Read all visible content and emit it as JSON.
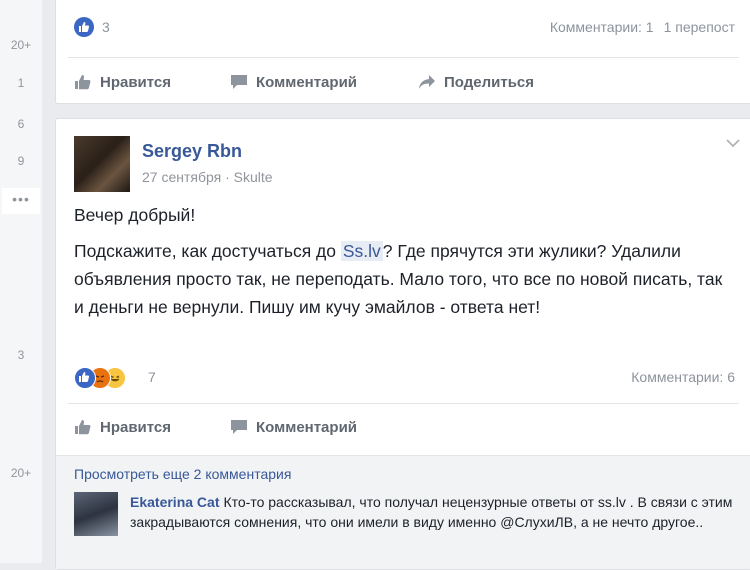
{
  "gutter": {
    "numbers": [
      "20+",
      "1",
      "6",
      "9",
      "3",
      "20+"
    ],
    "dots": "•••"
  },
  "post1": {
    "likes": "3",
    "comments": "Комментарии: 1",
    "shares": "1 перепост",
    "actions": {
      "like": "Нравится",
      "comment": "Комментарий",
      "share": "Поделиться"
    }
  },
  "post2": {
    "author": "Sergey Rbn",
    "date": "27 сентября",
    "location": "Skulte",
    "separator": "·",
    "greeting": "Вечер добрый!",
    "text_before_link": "Подскажите, как достучаться до ",
    "link": "Ss.lv",
    "text_after_link": "? Где прячутся эти жулики? Удалили объявления просто так, не переподать. Мало того, что все по новой писать, так и деньги не вернули. Пишу им кучу эмайлов - ответа нет!",
    "reaction_count": "7",
    "comments": "Комментарии: 6",
    "actions": {
      "like": "Нравится",
      "comment": "Комментарий"
    },
    "more_comments": "Просмотреть еще 2 комментария",
    "comment": {
      "author": "Ekaterina Cat",
      "text": "Кто-то рассказывал, что получал нецензурные ответы от ss.lv . В связи с этим закрадываются сомнения, что они имели в виду именно @СлухиЛВ, а не нечто другое.."
    }
  },
  "icons": [
    "like-icon",
    "comment-icon",
    "share-icon",
    "chevron-down-icon",
    "angry-reaction-icon",
    "haha-reaction-icon"
  ],
  "colors": {
    "link": "#385898",
    "like_badge": "#3b66c4",
    "background": "#e9ebee"
  }
}
